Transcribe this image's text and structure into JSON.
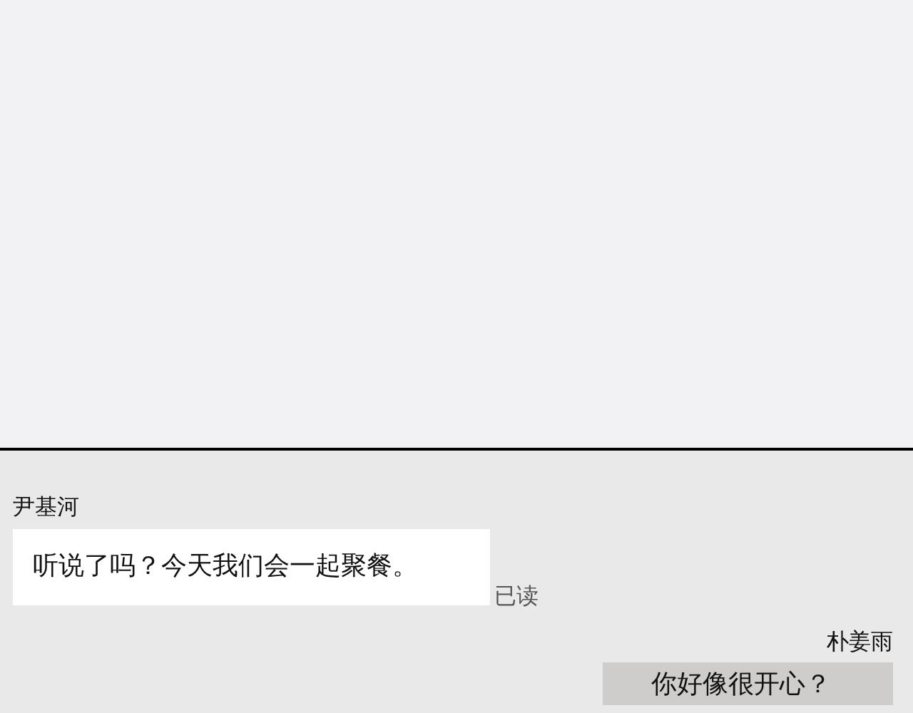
{
  "messages": [
    {
      "kind": "incoming",
      "sender": "尹基河",
      "text": "听说了吗？今天我们会一起聚餐。",
      "receipt": "已读"
    },
    {
      "kind": "outgoing",
      "sender": "朴姜雨",
      "text": "你好像很开心？"
    }
  ]
}
